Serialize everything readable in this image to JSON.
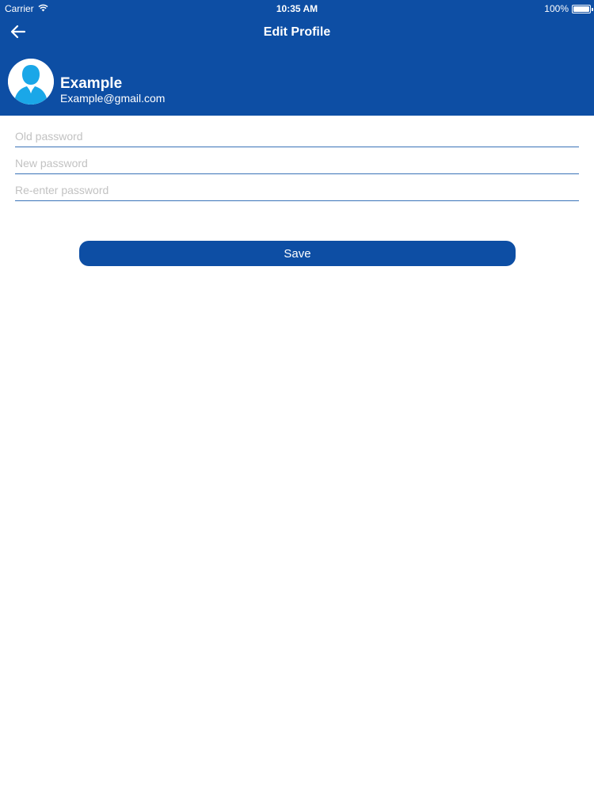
{
  "status_bar": {
    "carrier": "Carrier",
    "time": "10:35 AM",
    "battery": "100%",
    "battery_level": 1.0,
    "wifi_icon": "wifi-icon"
  },
  "nav": {
    "title": "Edit Profile",
    "back_icon": "arrow-left-icon"
  },
  "profile": {
    "name": "Example",
    "email": "Example@gmail.com",
    "avatar_icon": "user-avatar-icon"
  },
  "form": {
    "old_password": {
      "placeholder": "Old password",
      "value": ""
    },
    "new_password": {
      "placeholder": "New password",
      "value": ""
    },
    "confirm_password": {
      "placeholder": "Re-enter password",
      "value": ""
    }
  },
  "actions": {
    "save_label": "Save"
  },
  "colors": {
    "primary": "#0d4ea4",
    "field_line": "#3a73b8",
    "placeholder": "#c2c2c2",
    "avatar_accent": "#1aa7e8"
  }
}
